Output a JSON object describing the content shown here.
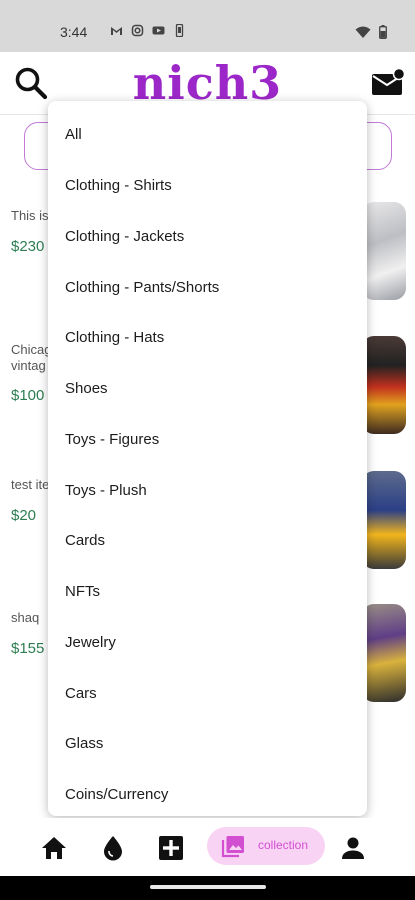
{
  "status_bar": {
    "time": "3:44"
  },
  "header": {
    "logo": "nich3"
  },
  "feed": [
    {
      "description": "This is",
      "price": "$230"
    },
    {
      "description": "Chicag\nvintag",
      "price": "$100"
    },
    {
      "description": "test ite",
      "price": "$20"
    },
    {
      "description": "shaq",
      "price": "$155"
    }
  ],
  "category_menu": {
    "items": [
      "All",
      "Clothing - Shirts",
      "Clothing - Jackets",
      "Clothing - Pants/Shorts",
      "Clothing - Hats",
      "Shoes",
      "Toys - Figures",
      "Toys - Plush",
      "Cards",
      "NFTs",
      "Jewelry",
      "Cars",
      "Glass",
      "Coins/Currency"
    ]
  },
  "bottom_nav": {
    "collection_label": "collection"
  },
  "colors": {
    "brand": "#9c27c9",
    "price": "#2e7d52",
    "collection_pill": "#f9d3f4"
  }
}
